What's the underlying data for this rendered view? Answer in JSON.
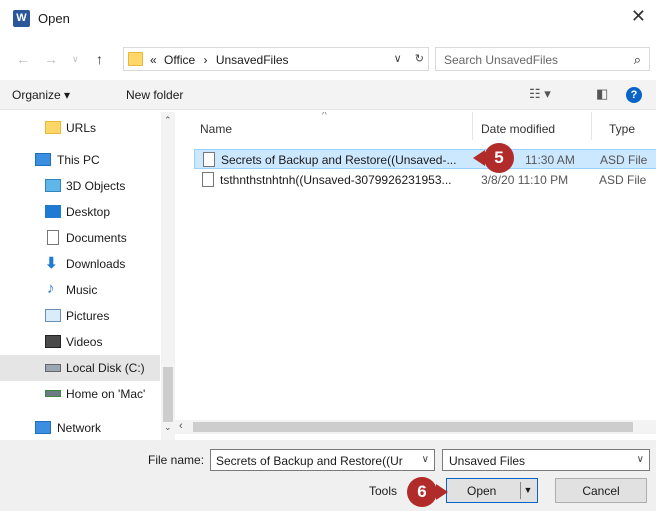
{
  "window": {
    "title": "Open",
    "app_icon": "W"
  },
  "address_bar": {
    "overflow": "«",
    "crumbs": [
      "Office",
      "UnsavedFiles"
    ],
    "separator": "›",
    "search_placeholder": "Search UnsavedFiles"
  },
  "toolbar": {
    "organize": "Organize ▾",
    "new_folder": "New folder"
  },
  "sidebar": {
    "items": [
      {
        "label": "URLs",
        "icon": "folder-icon"
      },
      {
        "label": "This PC",
        "icon": "computer-icon"
      },
      {
        "label": "3D Objects",
        "icon": "cube-icon"
      },
      {
        "label": "Desktop",
        "icon": "desktop-icon"
      },
      {
        "label": "Documents",
        "icon": "document-icon"
      },
      {
        "label": "Downloads",
        "icon": "download-icon"
      },
      {
        "label": "Music",
        "icon": "music-icon"
      },
      {
        "label": "Pictures",
        "icon": "pictures-icon"
      },
      {
        "label": "Videos",
        "icon": "video-icon"
      },
      {
        "label": "Local Disk (C:)",
        "icon": "drive-icon",
        "selected": true
      },
      {
        "label": "Home on 'Mac'",
        "icon": "network-drive-icon"
      },
      {
        "label": "Network",
        "icon": "network-icon"
      }
    ]
  },
  "file_list": {
    "columns": [
      "Name",
      "Date modified",
      "Type"
    ],
    "rows": [
      {
        "name": "Secrets of Backup and Restore((Unsaved-...",
        "date": "11:30 AM",
        "type": "ASD File",
        "selected": true
      },
      {
        "name": "tsthnthstnhtnh((Unsaved-3079926231953...",
        "date": "3/8/20 11:10 PM",
        "type": "ASD File",
        "selected": false
      }
    ]
  },
  "bottom": {
    "file_name_label": "File name:",
    "file_name_value": "Secrets of Backup and Restore((Ur",
    "file_type": "Unsaved Files",
    "tools": "Tools",
    "open": "Open",
    "cancel": "Cancel"
  },
  "callouts": {
    "step5": "5",
    "step6": "6"
  },
  "colors": {
    "accent": "#0a64c8",
    "callout": "#b12b2b",
    "selection": "#cce8ff",
    "folder": "#ffd768"
  }
}
